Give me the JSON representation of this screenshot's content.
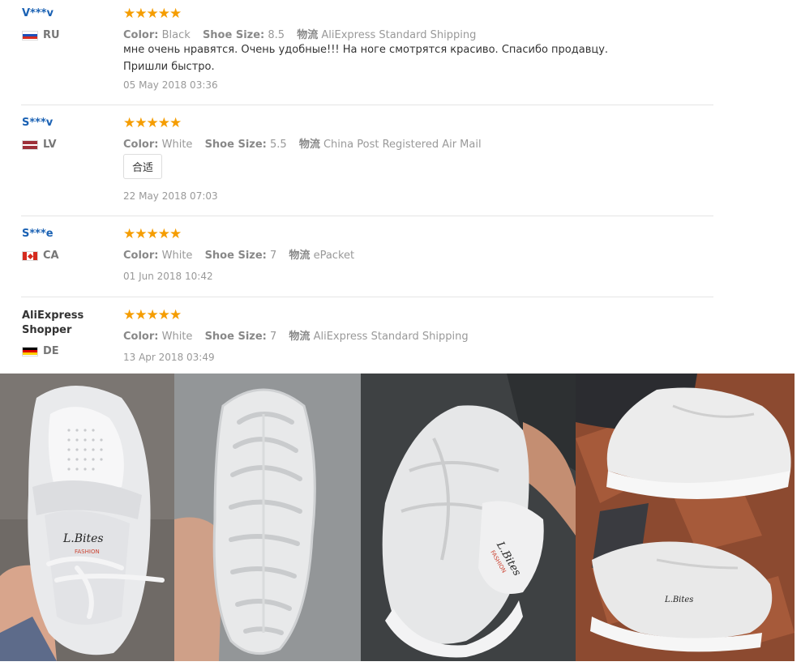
{
  "reviews": [
    {
      "user": "V***v",
      "country": "RU",
      "stars": "★★★★★",
      "color_label": "Color:",
      "color": "Black",
      "size_label": "Shoe Size:",
      "size": "8.5",
      "ship_label": "物流",
      "shipping": "AliExpress Standard Shipping",
      "text": "мне очень нравятся. Очень удобные!!! На ноге смотрятся красиво. Спасибо продавцу. Пришли быстро.",
      "date": "05 May 2018 03:36"
    },
    {
      "user": "S***v",
      "country": "LV",
      "stars": "★★★★★",
      "color_label": "Color:",
      "color": "White",
      "size_label": "Shoe Size:",
      "size": "5.5",
      "ship_label": "物流",
      "shipping": "China Post Registered Air Mail",
      "tag": "合适",
      "date": "22 May 2018 07:03"
    },
    {
      "user": "S***e",
      "country": "CA",
      "stars": "★★★★★",
      "color_label": "Color:",
      "color": "White",
      "size_label": "Shoe Size:",
      "size": "7",
      "ship_label": "物流",
      "shipping": "ePacket",
      "date": "01 Jun 2018 10:42"
    },
    {
      "user": "AliExpress Shopper",
      "country": "DE",
      "stars": "★★★★★",
      "color_label": "Color:",
      "color": "White",
      "size_label": "Shoe Size:",
      "size": "7",
      "ship_label": "物流",
      "shipping": "AliExpress Standard Shipping",
      "date": "13 Apr 2018 03:49"
    }
  ],
  "photo_text": {
    "brand": "L.Bites",
    "sub": "FASHION"
  },
  "colors": {
    "star": "#f59d00",
    "username": "#1b62b4",
    "divider": "#e5e5e5"
  }
}
